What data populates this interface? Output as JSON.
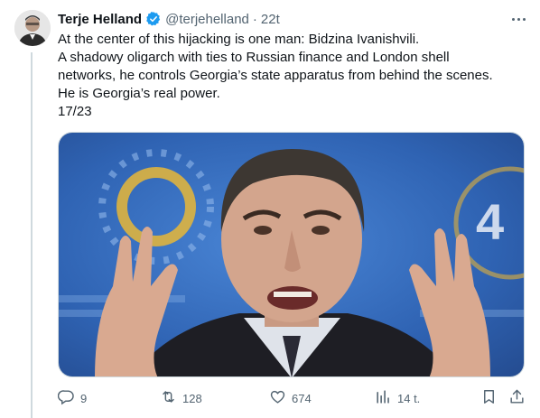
{
  "tweet": {
    "author_name": "Terje Helland",
    "handle": "@terjehelland",
    "separator": "·",
    "time": "22t",
    "lines": [
      "At the center of this hijacking is one man: Bidzina Ivanishvili.",
      "A shadowy oligarch with ties to Russian finance and London shell",
      "networks, he controls Georgia’s state apparatus from behind the scenes.",
      "He is Georgia’s real power.",
      "17/23"
    ]
  },
  "actions": {
    "replies": "9",
    "reposts": "128",
    "likes": "674",
    "views": "14 t."
  },
  "icons": {
    "verified": "verified-badge-icon",
    "more": "more-icon",
    "reply": "reply-icon",
    "repost": "repost-icon",
    "like": "heart-icon",
    "views": "views-icon",
    "bookmark": "bookmark-icon",
    "share": "share-icon"
  },
  "colors": {
    "verified": "#1d9bf0",
    "muted": "#536471",
    "text": "#0f1419",
    "thread_line": "#cfd9de",
    "photo_backdrop": "#2f63b3"
  }
}
